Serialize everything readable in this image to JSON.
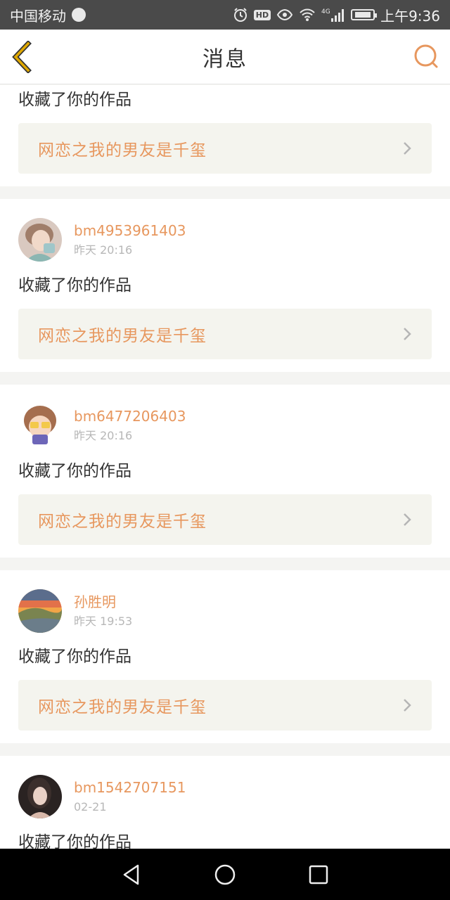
{
  "status_bar": {
    "carrier": "中国移动",
    "network_label": "4G",
    "time": "上午9:36",
    "battery_level": 0.85,
    "icons": [
      "globe-icon",
      "alarm-icon",
      "hd-icon",
      "eye-icon",
      "wifi-icon",
      "signal-icon",
      "battery-icon"
    ]
  },
  "header": {
    "title": "消息",
    "back_icon": "back-chevron-icon",
    "search_icon": "search-icon"
  },
  "colors": {
    "accent": "#e7975e",
    "back_icon": "#e0a800",
    "text": "#333333",
    "muted": "#b7b7b7",
    "link_bg": "#f4f4ee"
  },
  "notifications": [
    {
      "username": "",
      "time": "",
      "action": "收藏了你的作品",
      "work_title": "网恋之我的男友是千玺"
    },
    {
      "username": "bm4953961403",
      "time": "昨天 20:16",
      "action": "收藏了你的作品",
      "work_title": "网恋之我的男友是千玺",
      "avatar_icon": "avatar-photo-girl"
    },
    {
      "username": "bm6477206403",
      "time": "昨天 20:16",
      "action": "收藏了你的作品",
      "work_title": "网恋之我的男友是千玺",
      "avatar_icon": "avatar-cartoon-boy"
    },
    {
      "username": "孙胜明",
      "time": "昨天 19:53",
      "action": "收藏了你的作品",
      "work_title": "网恋之我的男友是千玺",
      "avatar_icon": "avatar-landscape-sunset"
    },
    {
      "username": "bm1542707151",
      "time": "02-21",
      "action": "收藏了你的作品",
      "work_title": "",
      "avatar_icon": "avatar-photo-woman"
    }
  ],
  "nav_bar": {
    "buttons": [
      "back-triangle-icon",
      "home-circle-icon",
      "recents-square-icon"
    ]
  }
}
